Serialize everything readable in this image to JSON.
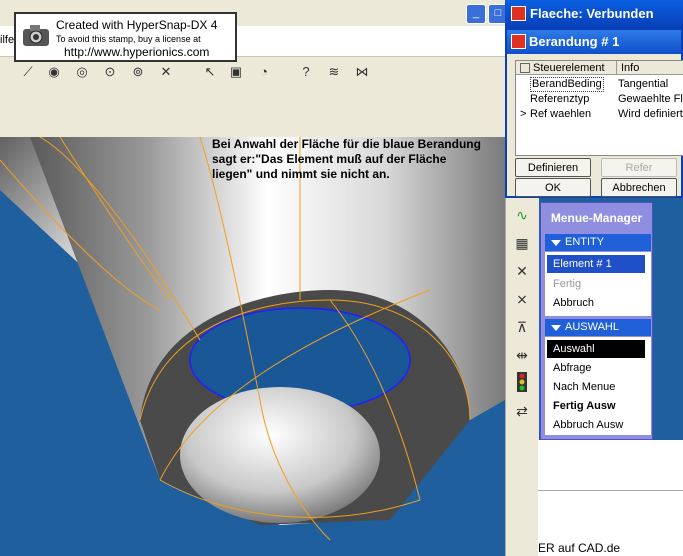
{
  "app": {
    "menubar_fragment": "ilfe",
    "window_buttons": [
      "_",
      "□"
    ]
  },
  "stamp": {
    "line1": "Created with HyperSnap-DX 4",
    "line2": "To avoid this stamp, buy a license at",
    "line3": "http://www.hyperionics.com"
  },
  "annotation": {
    "text": "Bei Anwahl der Fläche für die blaue Berandung sagt er:\"Das Element muß auf der Fläche liegen\" und nimmt sie nicht an."
  },
  "flaeche_window": {
    "title": "Flaeche: Verbunden"
  },
  "berandung_dialog": {
    "title": "Berandung # 1",
    "columns": [
      "Steuerelement",
      "Info"
    ],
    "rows": [
      {
        "marker": "",
        "element": "BerandBeding",
        "info": "Tangential"
      },
      {
        "marker": "",
        "element": "Referenztyp",
        "info": "Gewaehlte Fla"
      },
      {
        "marker": ">",
        "element": "Ref waehlen",
        "info": "Wird definiert"
      }
    ],
    "buttons": {
      "definieren": "Definieren",
      "refer": "Refer",
      "ok": "OK",
      "abbrechen": "Abbrechen"
    }
  },
  "menue_manager": {
    "title": "Menue-Manager",
    "entity_header": "ENTITY",
    "entity_items": [
      "Element # 1",
      "Fertig",
      "Abbruch"
    ],
    "auswahl_header": "AUSWAHL",
    "auswahl_items": [
      "Auswahl",
      "Abfrage",
      "Nach Menue",
      "Fertig Ausw",
      "Abbruch Ausw"
    ]
  },
  "bottom_text": "ER auf CAD.de",
  "colors": {
    "background_blue": "#1f5f9e",
    "titlebar_blue": "#0a5fe0",
    "menu_manager_bg": "#8f8ee0",
    "highlight": "#2050c8",
    "curve_orange": "#f0a020",
    "boundary_blue": "#2020ff"
  },
  "icons": [
    "magnifier-icon",
    "eye-icon",
    "arrow-select-icon",
    "query-help-icon",
    "layers-icon",
    "node-icon",
    "curve-icon",
    "grid-icon",
    "cross-icon",
    "traffic-light-icon",
    "swap-icon"
  ]
}
